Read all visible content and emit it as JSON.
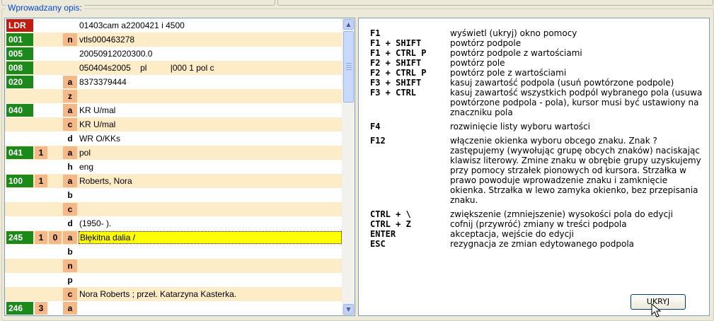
{
  "legend": "Wprowadzany opis:",
  "records": [
    {
      "tag": "LDR",
      "tag_color": "red",
      "ind1": "",
      "ind2": "",
      "sub": "",
      "value": "01403cam a2200421 i 4500",
      "shaded": false
    },
    {
      "tag": "001",
      "tag_color": "green",
      "ind1": "",
      "ind2": "",
      "sub": "n",
      "value": "vtls000463278",
      "shaded": true
    },
    {
      "tag": "005",
      "tag_color": "green",
      "ind1": "",
      "ind2": "",
      "sub": "",
      "value": "20050912020300.0",
      "shaded": false
    },
    {
      "tag": "008",
      "tag_color": "green",
      "ind1": "",
      "ind2": "",
      "sub": "",
      "value": "050404s2005    pl          |000 1 pol c",
      "shaded": true
    },
    {
      "tag": "020",
      "tag_color": "green",
      "ind1": "",
      "ind2": "",
      "sub": "a",
      "value": "8373379444",
      "shaded": false
    },
    {
      "tag": "",
      "tag_color": "",
      "ind1": "",
      "ind2": "",
      "sub": "z",
      "value": "",
      "shaded": true
    },
    {
      "tag": "040",
      "tag_color": "green",
      "ind1": "",
      "ind2": "",
      "sub": "a",
      "value": "KR U/mal",
      "shaded": false
    },
    {
      "tag": "",
      "tag_color": "",
      "ind1": "",
      "ind2": "",
      "sub": "c",
      "value": "KR U/mal",
      "shaded": true
    },
    {
      "tag": "",
      "tag_color": "",
      "ind1": "",
      "ind2": "",
      "sub": "d",
      "value": "WR O/KKs",
      "shaded": false
    },
    {
      "tag": "041",
      "tag_color": "green",
      "ind1": "1",
      "ind2": "",
      "sub": "a",
      "value": "pol",
      "shaded": true
    },
    {
      "tag": "",
      "tag_color": "",
      "ind1": "",
      "ind2": "",
      "sub": "h",
      "value": "eng",
      "shaded": false
    },
    {
      "tag": "100",
      "tag_color": "green",
      "ind1": "1",
      "ind2": "",
      "sub": "a",
      "value": "Roberts, Nora",
      "shaded": true
    },
    {
      "tag": "",
      "tag_color": "",
      "ind1": "",
      "ind2": "",
      "sub": "b",
      "value": "",
      "shaded": false
    },
    {
      "tag": "",
      "tag_color": "",
      "ind1": "",
      "ind2": "",
      "sub": "c",
      "value": "",
      "shaded": true
    },
    {
      "tag": "",
      "tag_color": "",
      "ind1": "",
      "ind2": "",
      "sub": "d",
      "value": "(1950- ).",
      "shaded": false
    },
    {
      "tag": "245",
      "tag_color": "green",
      "ind1": "1",
      "ind2": "0",
      "sub": "a",
      "value": "Błękitna dalia /",
      "shaded": true,
      "editing": true
    },
    {
      "tag": "",
      "tag_color": "",
      "ind1": "",
      "ind2": "",
      "sub": "b",
      "value": "",
      "shaded": false
    },
    {
      "tag": "",
      "tag_color": "",
      "ind1": "",
      "ind2": "",
      "sub": "n",
      "value": "",
      "shaded": true
    },
    {
      "tag": "",
      "tag_color": "",
      "ind1": "",
      "ind2": "",
      "sub": "p",
      "value": "",
      "shaded": false
    },
    {
      "tag": "",
      "tag_color": "",
      "ind1": "",
      "ind2": "",
      "sub": "c",
      "value": "Nora Roberts ; przeł. Katarzyna Kasterka.",
      "shaded": true
    },
    {
      "tag": "246",
      "tag_color": "green",
      "ind1": "3",
      "ind2": "",
      "sub": "a",
      "value": "",
      "shaded": false
    }
  ],
  "help": [
    {
      "key": "F1",
      "desc": "wyświetl (ukryj) okno pomocy"
    },
    {
      "key": "F1 + SHIFT",
      "desc": "powtórz podpole"
    },
    {
      "key": "F1 + CTRL P",
      "desc": "powtórz podpole z wartościami"
    },
    {
      "key": "F2 + SHIFT",
      "desc": "powtórz pole"
    },
    {
      "key": "F2 + CTRL P",
      "desc": "powtórz pole z wartościami"
    },
    {
      "key": "F3 + SHIFT",
      "desc": "kasuj zawartość podpola (usuń powtórzone podpole)"
    },
    {
      "key": "F3 + CTRL",
      "desc": "kasuj zawartość wszystkich podpól wybranego pola (usuwa powtórzone podpola - pola), kursor musi być ustawiony na znaczniku pola",
      "gap_after": true
    },
    {
      "key": "F4",
      "desc": "rozwinięcie listy wyboru wartości",
      "gap_after": true
    },
    {
      "key": "F12",
      "desc": "włączenie okienka wyboru obcego znaku. Znak ? zastępujemy (wywołując grupę obcych znaków) naciskając klawisz literowy. Zmine znaku w obrębie grupy uzyskujemy przy pomocy strzałek pionowych od kursora. Strzałka w prawo powoduje wprowadzenie znaku i zamknięcie okienka. Strzałka w lewo zamyka okienko, bez przepisania znaku."
    },
    {
      "key": "CTRL + \\",
      "desc": "zwiększenie (zmniejszenie) wysokości pola do edycji"
    },
    {
      "key": "CTRL + Z",
      "desc": "cofnij (przywróć) zmiany w treści podpola"
    },
    {
      "key": "ENTER",
      "desc": "akceptacja, wejście do edycji"
    },
    {
      "key": "ESC",
      "desc": "rezygnacja ze zmian edytowanego podpola"
    }
  ],
  "hide_button": "UKRYJ",
  "icons": {
    "scroll_up": "scroll-up-arrow-icon",
    "scroll_down": "scroll-down-arrow-icon",
    "cursor": "mouse-pointer-icon"
  }
}
